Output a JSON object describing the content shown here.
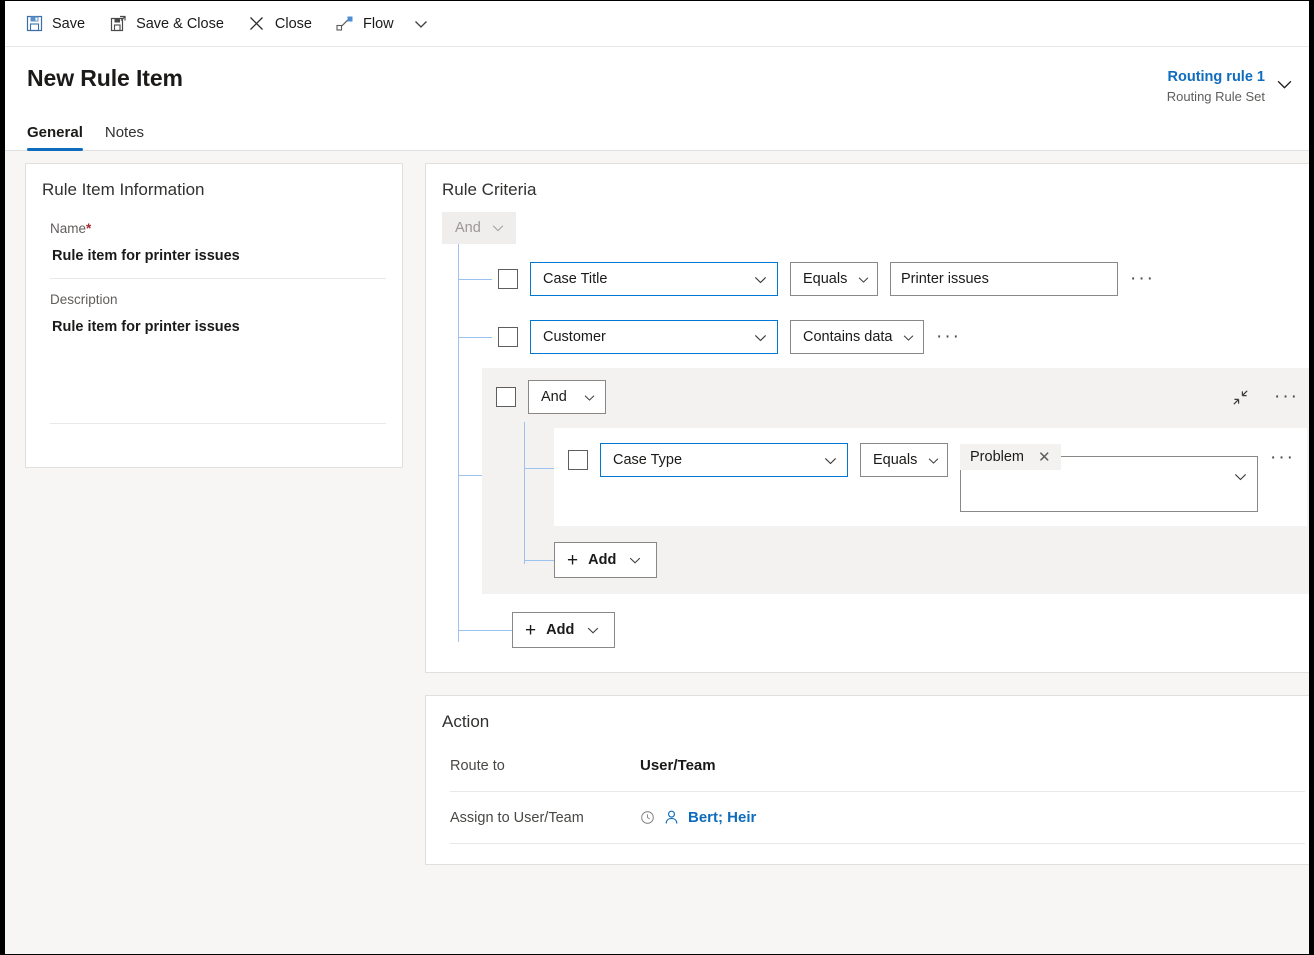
{
  "commandbar": {
    "buttons": [
      {
        "label": "Save",
        "icon": "save-icon"
      },
      {
        "label": "Save & Close",
        "icon": "save-and-close-icon"
      },
      {
        "label": "Close",
        "icon": "close-x-icon"
      },
      {
        "label": "Flow",
        "icon": "flow-icon"
      }
    ],
    "overflow_label": "chevron-down-icon"
  },
  "header": {
    "title": "New Rule Item",
    "context_title": "Routing rule 1",
    "context_subtitle": "Routing Rule Set",
    "tabs": [
      {
        "label": "General",
        "active": true
      },
      {
        "label": "Notes",
        "active": false
      }
    ]
  },
  "rule_item_information": {
    "section_title": "Rule Item Information",
    "name_label": "Name",
    "name_required": "*",
    "name_value": "Rule item for printer issues",
    "description_label": "Description",
    "description_value": "Rule item for printer issues"
  },
  "rule_criteria": {
    "section_title": "Rule Criteria",
    "root_operator": "And",
    "rows": [
      {
        "field": "Case Title",
        "operator": "Equals",
        "value": "Printer issues",
        "more": "···"
      },
      {
        "field": "Customer",
        "operator": "Contains data",
        "value": null,
        "more": "···"
      }
    ],
    "group": {
      "operator": "And",
      "collapse_icon": "collapse-diagonal-icon",
      "more": "···",
      "rows": [
        {
          "field": "Case Type",
          "operator": "Equals",
          "chip": "Problem",
          "chip_remove": "✕",
          "more": "···"
        }
      ],
      "add_label": "Add"
    },
    "add_label": "Add"
  },
  "action": {
    "section_title": "Action",
    "route_to_label": "Route to",
    "route_to_value": "User/Team",
    "assign_label": "Assign to User/Team",
    "assign_value": "Bert; Heir",
    "assign_icons": [
      "recent-clock-icon",
      "person-icon"
    ]
  },
  "colors": {
    "accent_blue": "#0f6cbd",
    "field_border_blue": "#0078d4",
    "tree_line_blue": "#9cc3f0",
    "required_red": "#a4262c",
    "group_bg": "#f3f2f1",
    "page_bg": "#f7f6f5"
  }
}
